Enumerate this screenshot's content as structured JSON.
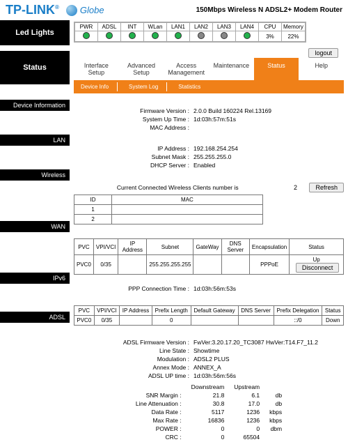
{
  "header": {
    "brand": "TP-LINK",
    "partner": "Globe",
    "product": "150Mbps Wireless N ADSL2+ Modem Router",
    "logout": "logout"
  },
  "sidebar": {
    "led_lights": "Led Lights",
    "status": "Status",
    "sections": {
      "device_info": "Device Information",
      "lan": "LAN",
      "wireless": "Wireless",
      "wan": "WAN",
      "ipv6": "IPv6",
      "adsl": "ADSL"
    }
  },
  "leds": {
    "cols": [
      "PWR",
      "ADSL",
      "INT",
      "WLan",
      "LAN1",
      "LAN2",
      "LAN3",
      "LAN4",
      "CPU",
      "Memory"
    ],
    "states": [
      "green",
      "green",
      "green",
      "green",
      "green",
      "gray",
      "gray",
      "green",
      "",
      ""
    ],
    "cpu": "3%",
    "memory": "22%"
  },
  "tabs": {
    "items": [
      "Interface Setup",
      "Advanced Setup",
      "Access Management",
      "Maintenance",
      "Status",
      "Help"
    ],
    "active": 4
  },
  "subtabs": {
    "items": [
      "Device Info",
      "System Log",
      "Statistics"
    ]
  },
  "device_info": {
    "fw_label": "Firmware Version :",
    "fw": "2.0.0 Build 160224 Rel.13169",
    "uptime_label": "System Up Time :",
    "uptime": "1d:03h:57m:51s",
    "mac_label": "MAC Address :",
    "mac": ""
  },
  "lan": {
    "ip_label": "IP Address :",
    "ip": "192.168.254.254",
    "mask_label": "Subnet Mask :",
    "mask": "255.255.255.0",
    "dhcp_label": "DHCP Server :",
    "dhcp": "Enabled"
  },
  "wireless": {
    "clients_label": "Current Connected Wireless Clients number is",
    "clients": "2",
    "refresh": "Refresh",
    "cols": {
      "id": "ID",
      "mac": "MAC"
    },
    "rows": [
      {
        "id": "1",
        "mac": ""
      },
      {
        "id": "2",
        "mac": ""
      }
    ]
  },
  "wan": {
    "cols": [
      "PVC",
      "VPI/VCI",
      "IP Address",
      "Subnet",
      "GateWay",
      "DNS Server",
      "Encapsulation",
      "Status"
    ],
    "row": {
      "pvc": "PVC0",
      "vpi": "0/35",
      "ip": "",
      "subnet": "255.255.255.255",
      "gw": "",
      "dns": "",
      "encap": "PPPoE",
      "up": "Up",
      "status": "Disconnect"
    },
    "ppp_label": "PPP Connection Time :",
    "ppp_time": "1d:03h:56m:53s"
  },
  "ipv6": {
    "cols": [
      "PVC",
      "VPI/VCI",
      "IP Address",
      "Prefix Length",
      "Default Gateway",
      "DNS Server",
      "Prefix Delegation",
      "Status"
    ],
    "row": {
      "pvc": "PVC0",
      "vpi": "0/35",
      "ip": "",
      "plen": "0",
      "gw": "",
      "dns": "",
      "pd": "::/0",
      "status": "Down"
    }
  },
  "adsl": {
    "fw_label": "ADSL Firmware Version :",
    "fw": "FwVer:3.20.17.20_TC3087 HwVer:T14.F7_11.2",
    "line_label": "Line State :",
    "line": "Showtime",
    "mod_label": "Modulation :",
    "mod": "ADSL2 PLUS",
    "annex_label": "Annex Mode :",
    "annex": "ANNEX_A",
    "up_label": "ADSL UP time :",
    "up": "1d:03h:56m:56s",
    "stats": {
      "head": {
        "down": "Downstream",
        "up": "Upstream"
      },
      "rows": [
        {
          "label": "SNR Margin :",
          "d": "21.8",
          "u": "6.1",
          "unit": "db"
        },
        {
          "label": "Line Attenuation :",
          "d": "30.8",
          "u": "17.0",
          "unit": "db"
        },
        {
          "label": "Data Rate :",
          "d": "5117",
          "u": "1236",
          "unit": "kbps"
        },
        {
          "label": "Max Rate :",
          "d": "16836",
          "u": "1236",
          "unit": "kbps"
        },
        {
          "label": "POWER :",
          "d": "0",
          "u": "0",
          "unit": "dbm"
        },
        {
          "label": "CRC :",
          "d": "0",
          "u": "65504",
          "unit": ""
        }
      ]
    }
  }
}
